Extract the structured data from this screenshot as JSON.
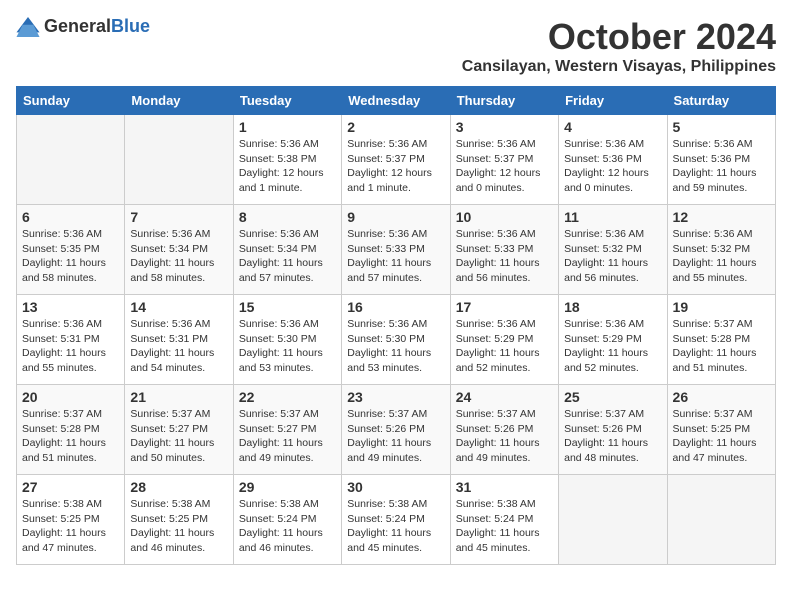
{
  "logo": {
    "general": "General",
    "blue": "Blue"
  },
  "title": "October 2024",
  "location": "Cansilayan, Western Visayas, Philippines",
  "weekdays": [
    "Sunday",
    "Monday",
    "Tuesday",
    "Wednesday",
    "Thursday",
    "Friday",
    "Saturday"
  ],
  "weeks": [
    [
      {
        "day": "",
        "info": ""
      },
      {
        "day": "",
        "info": ""
      },
      {
        "day": "1",
        "info": "Sunrise: 5:36 AM\nSunset: 5:38 PM\nDaylight: 12 hours\nand 1 minute."
      },
      {
        "day": "2",
        "info": "Sunrise: 5:36 AM\nSunset: 5:37 PM\nDaylight: 12 hours\nand 1 minute."
      },
      {
        "day": "3",
        "info": "Sunrise: 5:36 AM\nSunset: 5:37 PM\nDaylight: 12 hours\nand 0 minutes."
      },
      {
        "day": "4",
        "info": "Sunrise: 5:36 AM\nSunset: 5:36 PM\nDaylight: 12 hours\nand 0 minutes."
      },
      {
        "day": "5",
        "info": "Sunrise: 5:36 AM\nSunset: 5:36 PM\nDaylight: 11 hours\nand 59 minutes."
      }
    ],
    [
      {
        "day": "6",
        "info": "Sunrise: 5:36 AM\nSunset: 5:35 PM\nDaylight: 11 hours\nand 58 minutes."
      },
      {
        "day": "7",
        "info": "Sunrise: 5:36 AM\nSunset: 5:34 PM\nDaylight: 11 hours\nand 58 minutes."
      },
      {
        "day": "8",
        "info": "Sunrise: 5:36 AM\nSunset: 5:34 PM\nDaylight: 11 hours\nand 57 minutes."
      },
      {
        "day": "9",
        "info": "Sunrise: 5:36 AM\nSunset: 5:33 PM\nDaylight: 11 hours\nand 57 minutes."
      },
      {
        "day": "10",
        "info": "Sunrise: 5:36 AM\nSunset: 5:33 PM\nDaylight: 11 hours\nand 56 minutes."
      },
      {
        "day": "11",
        "info": "Sunrise: 5:36 AM\nSunset: 5:32 PM\nDaylight: 11 hours\nand 56 minutes."
      },
      {
        "day": "12",
        "info": "Sunrise: 5:36 AM\nSunset: 5:32 PM\nDaylight: 11 hours\nand 55 minutes."
      }
    ],
    [
      {
        "day": "13",
        "info": "Sunrise: 5:36 AM\nSunset: 5:31 PM\nDaylight: 11 hours\nand 55 minutes."
      },
      {
        "day": "14",
        "info": "Sunrise: 5:36 AM\nSunset: 5:31 PM\nDaylight: 11 hours\nand 54 minutes."
      },
      {
        "day": "15",
        "info": "Sunrise: 5:36 AM\nSunset: 5:30 PM\nDaylight: 11 hours\nand 53 minutes."
      },
      {
        "day": "16",
        "info": "Sunrise: 5:36 AM\nSunset: 5:30 PM\nDaylight: 11 hours\nand 53 minutes."
      },
      {
        "day": "17",
        "info": "Sunrise: 5:36 AM\nSunset: 5:29 PM\nDaylight: 11 hours\nand 52 minutes."
      },
      {
        "day": "18",
        "info": "Sunrise: 5:36 AM\nSunset: 5:29 PM\nDaylight: 11 hours\nand 52 minutes."
      },
      {
        "day": "19",
        "info": "Sunrise: 5:37 AM\nSunset: 5:28 PM\nDaylight: 11 hours\nand 51 minutes."
      }
    ],
    [
      {
        "day": "20",
        "info": "Sunrise: 5:37 AM\nSunset: 5:28 PM\nDaylight: 11 hours\nand 51 minutes."
      },
      {
        "day": "21",
        "info": "Sunrise: 5:37 AM\nSunset: 5:27 PM\nDaylight: 11 hours\nand 50 minutes."
      },
      {
        "day": "22",
        "info": "Sunrise: 5:37 AM\nSunset: 5:27 PM\nDaylight: 11 hours\nand 49 minutes."
      },
      {
        "day": "23",
        "info": "Sunrise: 5:37 AM\nSunset: 5:26 PM\nDaylight: 11 hours\nand 49 minutes."
      },
      {
        "day": "24",
        "info": "Sunrise: 5:37 AM\nSunset: 5:26 PM\nDaylight: 11 hours\nand 49 minutes."
      },
      {
        "day": "25",
        "info": "Sunrise: 5:37 AM\nSunset: 5:26 PM\nDaylight: 11 hours\nand 48 minutes."
      },
      {
        "day": "26",
        "info": "Sunrise: 5:37 AM\nSunset: 5:25 PM\nDaylight: 11 hours\nand 47 minutes."
      }
    ],
    [
      {
        "day": "27",
        "info": "Sunrise: 5:38 AM\nSunset: 5:25 PM\nDaylight: 11 hours\nand 47 minutes."
      },
      {
        "day": "28",
        "info": "Sunrise: 5:38 AM\nSunset: 5:25 PM\nDaylight: 11 hours\nand 46 minutes."
      },
      {
        "day": "29",
        "info": "Sunrise: 5:38 AM\nSunset: 5:24 PM\nDaylight: 11 hours\nand 46 minutes."
      },
      {
        "day": "30",
        "info": "Sunrise: 5:38 AM\nSunset: 5:24 PM\nDaylight: 11 hours\nand 45 minutes."
      },
      {
        "day": "31",
        "info": "Sunrise: 5:38 AM\nSunset: 5:24 PM\nDaylight: 11 hours\nand 45 minutes."
      },
      {
        "day": "",
        "info": ""
      },
      {
        "day": "",
        "info": ""
      }
    ]
  ]
}
